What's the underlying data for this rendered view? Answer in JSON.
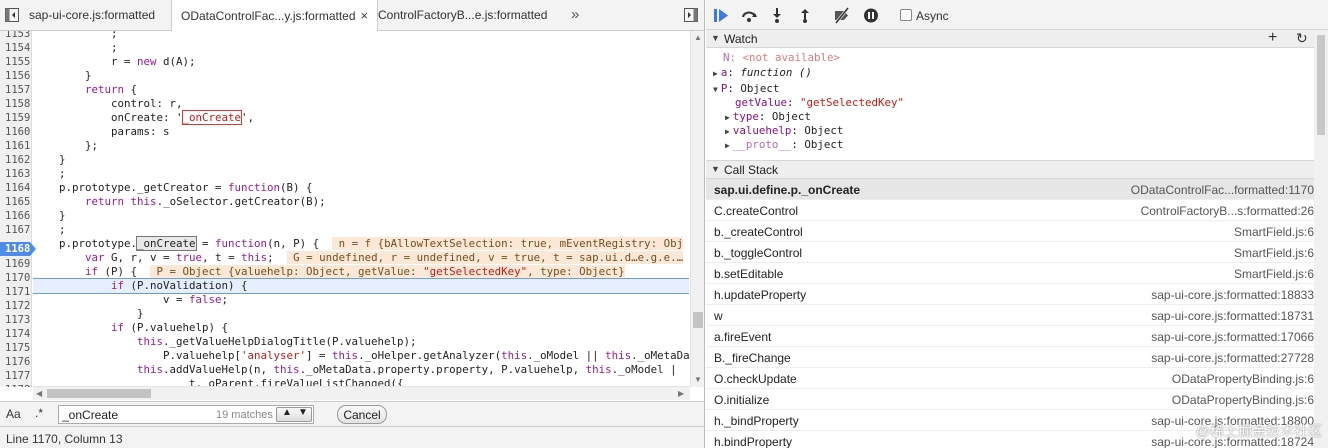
{
  "tabs": [
    {
      "label": "sap-ui-core.js:formatted",
      "active": false
    },
    {
      "label": "ODataControlFac...y.js:formatted",
      "active": true,
      "close": "×"
    },
    {
      "label": "ControlFactoryB...e.js:formatted",
      "active": false
    }
  ],
  "tab_overflow": "»",
  "editor": {
    "line_numbers": [
      "1153",
      "1154",
      "1155",
      "1156",
      "1157",
      "1158",
      "1159",
      "1160",
      "1161",
      "1162",
      "1163",
      "1164",
      "1165",
      "1166",
      "1167",
      "1168",
      "1169",
      "1170",
      "1171",
      "1172",
      "1173",
      "1174",
      "1175",
      "1176",
      "1177",
      "1178"
    ],
    "breakpoint_line": "1168",
    "execution_line": "1170",
    "code": {
      "l1153": "            ;",
      "l1154": "            ;",
      "l1155a": "            r = ",
      "l1155kw": "new",
      "l1155b": " d(A);",
      "l1156": "        }",
      "l1157kw": "return",
      "l1157b": " {",
      "l1158a": "            control: r,",
      "l1159a": "            onCreate: '",
      "l1159s": "_onCreate",
      "l1159b": "',",
      "l1160": "            params: s",
      "l1161": "        };",
      "l1162": "    }",
      "l1163": "    ;",
      "l1164a": "    p.prototype._getCreator = ",
      "l1164kw": "function",
      "l1164b": "(B) {",
      "l1165kw": "return",
      "l1165kw2": "this",
      "l1165b": "._oSelector.getCreator(B);",
      "l1166": "    }",
      "l1167": "    ;",
      "l1168a": "    p.prototype.",
      "l1168h": "_onCreate",
      "l1168b": " = ",
      "l1168kw": "function",
      "l1168c": "(n, P) {  ",
      "l1168v": " n = f {bAllowTextSelection: true, mEventRegistry: Obj",
      "l1169kw": "var",
      "l1169a": " G, r, v = ",
      "l1169kw2": "true",
      "l1169b": ", t = ",
      "l1169kw3": "this",
      "l1169c": ";  ",
      "l1169v": " G = undefined, r = undefined, v = true, t = sap.ui.d…e.g.e.…",
      "l1170kw": "if",
      "l1170a": " (P) {  ",
      "l1170v1": " P = Object {valuehelp: Object, getValue: ",
      "l1170vs": "\"getSelectedKey\"",
      "l1170v2": ", type: Object}",
      "l1171kw": "if",
      "l1171a": " (P.noValidation) {",
      "l1172a": "                    v = ",
      "l1172kw": "false",
      "l1172b": ";",
      "l1173": "                }",
      "l1174kw": "if",
      "l1174a": " (P.valuehelp) {",
      "l1175kw": "this",
      "l1175a": "._getValueHelpDialogTitle(P.valuehelp);",
      "l1176a": "                    P.valuehelp[",
      "l1176s": "'analyser'",
      "l1176b": "] = ",
      "l1176kw": "this",
      "l1176c": "._oHelper.getAnalyzer(",
      "l1176kw2": "this",
      "l1176d": "._oModel || ",
      "l1176kw3": "this",
      "l1176e": "._oMetaData",
      "l1177kw": "this",
      "l1177a": ".addValueHelp(n, ",
      "l1177kw2": "this",
      "l1177b": "._oMetaData.property.property, P.valuehelp, ",
      "l1177kw3": "this",
      "l1177c": "._oModel |",
      "l1178a": "                        t._oParent.fireValueListChanged({"
    }
  },
  "search": {
    "case_label": "Aa",
    "regex_label": ".*",
    "value": "_onCreate",
    "match_count": "19 matches",
    "prev": "▲",
    "next": "▼",
    "cancel_label": "Cancel"
  },
  "status": "Line 1170, Column 13",
  "debugger": {
    "async_label": "Async",
    "watch": {
      "title": "Watch",
      "add": "+",
      "refresh": "↻",
      "items": {
        "n_key": "N",
        "n_val": "<not available>",
        "a_key": "a",
        "a_val": "function ()",
        "p_key": "P",
        "p_val": "Object",
        "getvalue_key": "getValue",
        "getvalue_val": "\"getSelectedKey\"",
        "type_key": "type",
        "type_val": "Object",
        "valuehelp_key": "valuehelp",
        "valuehelp_val": "Object",
        "proto_key": "__proto__",
        "proto_val": "Object"
      }
    },
    "callstack": {
      "title": "Call Stack",
      "frames": [
        {
          "name": "sap.ui.define.p._onCreate",
          "location": "ODataControlFac...formatted:1170"
        },
        {
          "name": "C.createControl",
          "location": "ControlFactoryB...s:formatted:26"
        },
        {
          "name": "b._createControl",
          "location": "SmartField.js:6"
        },
        {
          "name": "b._toggleControl",
          "location": "SmartField.js:6"
        },
        {
          "name": "b.setEditable",
          "location": "SmartField.js:6"
        },
        {
          "name": "h.updateProperty",
          "location": "sap-ui-core.js:formatted:18833"
        },
        {
          "name": "w",
          "location": "sap-ui-core.js:formatted:18731"
        },
        {
          "name": "a.fireEvent",
          "location": "sap-ui-core.js:formatted:17066"
        },
        {
          "name": "B._fireChange",
          "location": "sap-ui-core.js:formatted:27728"
        },
        {
          "name": "O.checkUpdate",
          "location": "ODataPropertyBinding.js:6"
        },
        {
          "name": "O.initialize",
          "location": "ODataPropertyBinding.js:6"
        },
        {
          "name": "h._bindProperty",
          "location": "sap-ui-core.js:formatted:18800"
        },
        {
          "name": "h.bindProperty",
          "location": "sap-ui-core.js:formatted:18724"
        }
      ]
    }
  },
  "watermark": "@稀土掘金技术社区",
  "colors": {
    "accent": "#4f8ce8",
    "keyword": "#9a1a9a",
    "string": "#c41a16",
    "inline_value_bg": "#fbe8d6"
  }
}
